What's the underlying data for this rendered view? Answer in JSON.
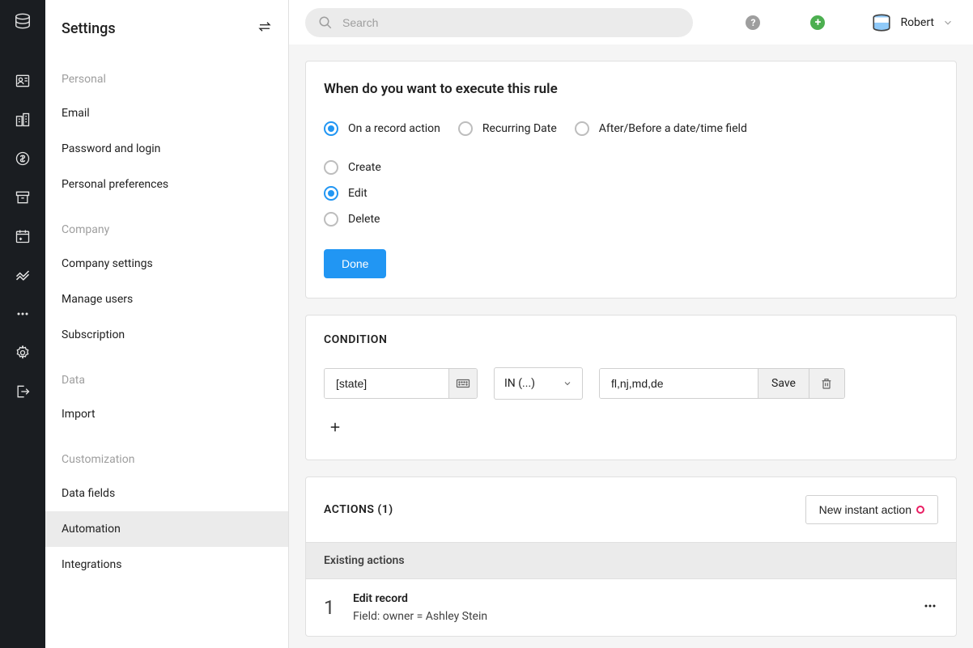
{
  "sidebar": {
    "title": "Settings",
    "sections": [
      {
        "label": "Personal",
        "items": [
          "Email",
          "Password and login",
          "Personal preferences"
        ]
      },
      {
        "label": "Company",
        "items": [
          "Company settings",
          "Manage users",
          "Subscription"
        ]
      },
      {
        "label": "Data",
        "items": [
          "Import"
        ]
      },
      {
        "label": "Customization",
        "items": [
          "Data fields",
          "Automation",
          "Integrations"
        ]
      }
    ],
    "activeItem": "Automation"
  },
  "topbar": {
    "searchPlaceholder": "Search",
    "userName": "Robert"
  },
  "whenCard": {
    "title": "When do you want to execute this rule",
    "triggers": [
      {
        "label": "On a record action",
        "selected": true
      },
      {
        "label": "Recurring Date",
        "selected": false
      },
      {
        "label": "After/Before a date/time field",
        "selected": false
      }
    ],
    "recordActions": [
      {
        "label": "Create",
        "selected": false
      },
      {
        "label": "Edit",
        "selected": true
      },
      {
        "label": "Delete",
        "selected": false
      }
    ],
    "doneLabel": "Done"
  },
  "conditionCard": {
    "title": "CONDITION",
    "field": "[state]",
    "operator": "IN (...)",
    "value": "fl,nj,md,de",
    "saveLabel": "Save"
  },
  "actionsCard": {
    "title": "ACTIONS (1)",
    "newActionLabel": "New instant action",
    "existingLabel": "Existing actions",
    "items": [
      {
        "number": "1",
        "name": "Edit record",
        "description": "Field: owner = Ashley Stein"
      }
    ]
  }
}
